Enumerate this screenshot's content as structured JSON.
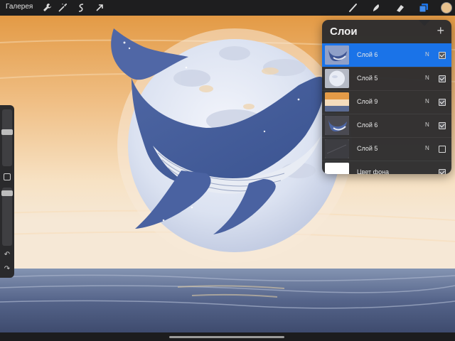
{
  "toolbar": {
    "gallery_label": "Галерея",
    "left_tools": [
      {
        "icon": "wrench-icon"
      },
      {
        "icon": "magic-wand-icon"
      },
      {
        "icon": "selection-icon"
      },
      {
        "icon": "transform-arrow-icon"
      }
    ],
    "right_tools": [
      {
        "icon": "brush-icon"
      },
      {
        "icon": "smudge-icon"
      },
      {
        "icon": "eraser-icon"
      },
      {
        "icon": "layers-icon",
        "active": true
      },
      {
        "icon": "color-swatch-icon"
      }
    ],
    "accent_color": "#1a73e8",
    "current_color": "#e8c18d"
  },
  "layers_panel": {
    "title": "Слои",
    "add_label": "+",
    "layers": [
      {
        "name": "Слой 6",
        "mode": "N",
        "visible": true,
        "selected": true,
        "thumb": "whale"
      },
      {
        "name": "Слой 5",
        "mode": "N",
        "visible": true,
        "selected": false,
        "thumb": "moon"
      },
      {
        "name": "Слой 9",
        "mode": "N",
        "visible": true,
        "selected": false,
        "thumb": "sky"
      },
      {
        "name": "Слой 6",
        "mode": "N",
        "visible": true,
        "selected": false,
        "thumb": "whale"
      },
      {
        "name": "Слой 5",
        "mode": "N",
        "visible": false,
        "selected": false,
        "thumb": "dark"
      },
      {
        "name": "Цвет фона",
        "mode": "",
        "visible": true,
        "selected": false,
        "thumb": "white"
      }
    ]
  },
  "sidebar": {
    "undo_label": "↶",
    "redo_label": "↷"
  }
}
